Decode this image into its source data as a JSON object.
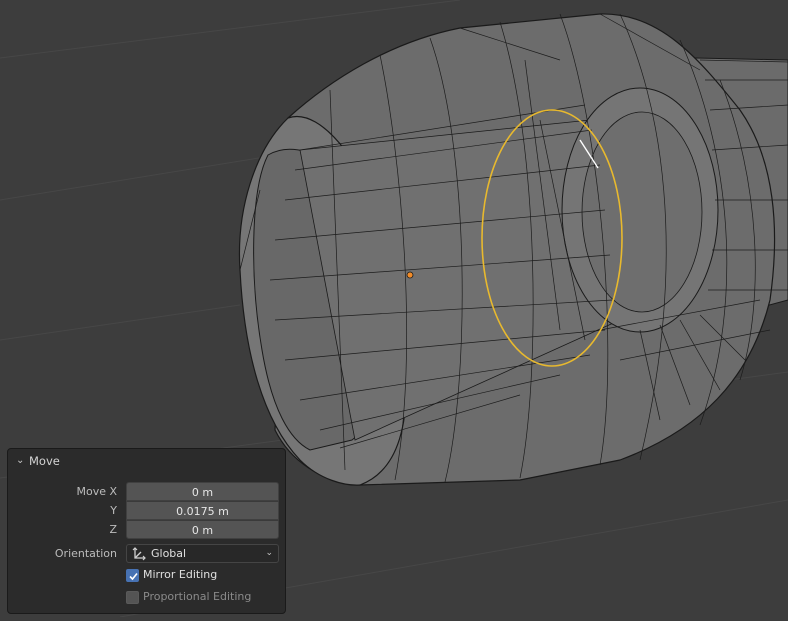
{
  "viewport": {
    "background_color": "#3d3d3d",
    "mesh_fill_color": "#6a6a6a",
    "wire_color": "#1a1a1a",
    "selection_color": "#f1c232",
    "origin_color": "#f28c28"
  },
  "operator_panel": {
    "title": "Move",
    "move_x_label": "Move X",
    "move_x_value": "0 m",
    "y_label": "Y",
    "y_value": "0.0175 m",
    "z_label": "Z",
    "z_value": "0 m",
    "orientation_label": "Orientation",
    "orientation_value": "Global",
    "mirror_editing_label": "Mirror Editing",
    "mirror_editing_checked": true,
    "proportional_editing_label": "Proportional Editing",
    "proportional_editing_checked": false,
    "accent_color": "#4772b3"
  }
}
